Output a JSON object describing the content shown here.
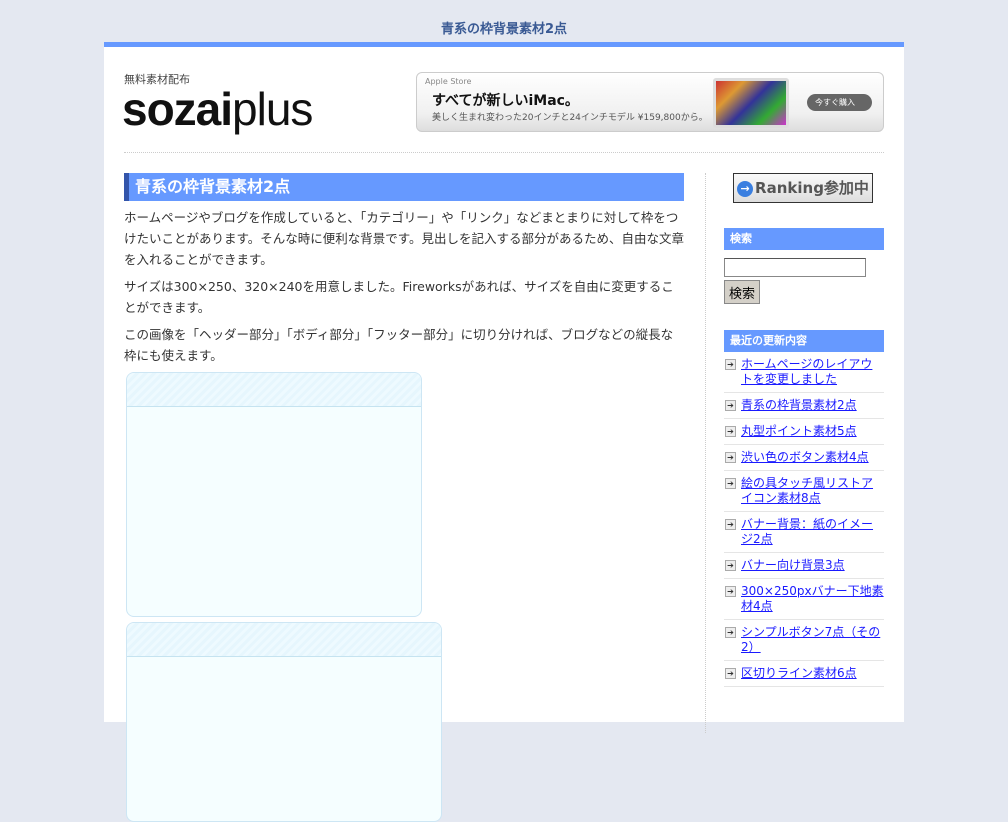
{
  "site_title": "青系の枠背景素材2点",
  "header": {
    "tagline": "無料素材配布",
    "logo_bold": "sozai",
    "logo_light": "plus",
    "banner": {
      "store": "Apple Store",
      "headline": "すべてが新しいiMac。",
      "sub": "美しく生まれ変わった20インチと24インチモデル ¥159,800から。",
      "button": "今すぐ購入"
    }
  },
  "main": {
    "title": "青系の枠背景素材2点",
    "paragraphs": [
      "ホームページやブログを作成していると、「カテゴリー」や「リンク」などまとまりに対して枠をつけたいことがあります。そんな時に便利な背景です。見出しを記入する部分があるため、自由な文章を入れることができます。",
      "サイズは300×250、320×240を用意しました。Fireworksがあれば、サイズを自由に変更することができます。",
      "この画像を「ヘッダー部分」「ボディ部分」「フッター部分」に切り分ければ、ブログなどの縦長な枠にも使えます。"
    ]
  },
  "sidebar": {
    "ranking": "Ranking参加中",
    "search_title": "検索",
    "search_value": "",
    "search_button": "検索",
    "recent_title": "最近の更新内容",
    "recent": [
      "ホームページのレイアウトを変更しました",
      "青系の枠背景素材2点",
      "丸型ポイント素材5点",
      "渋い色のボタン素材4点",
      "絵の具タッチ風リストアイコン素材8点",
      "バナー背景：紙のイメージ2点",
      "バナー向け背景3点",
      "300×250pxバナー下地素材4点",
      "シンプルボタン7点（その2）",
      "区切りライン素材6点"
    ]
  }
}
